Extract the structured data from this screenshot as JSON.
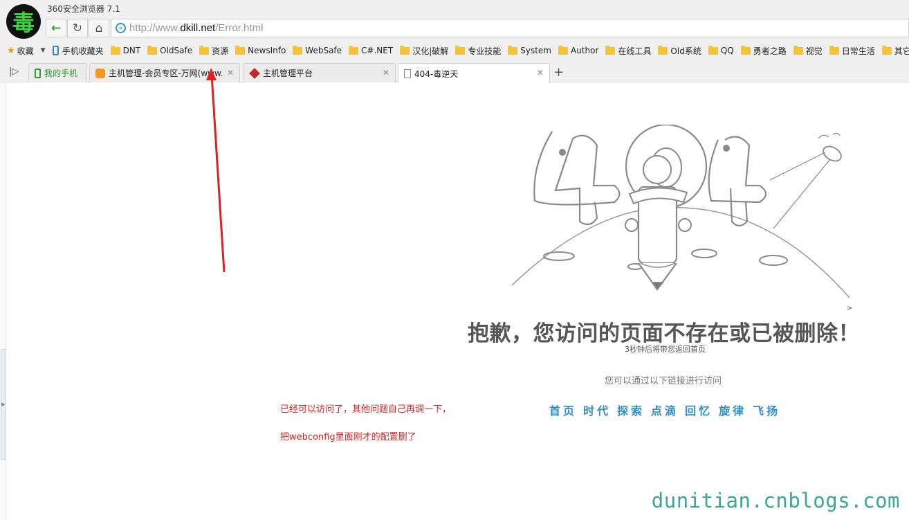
{
  "browser": {
    "app_title": "360安全浏览器 7.1",
    "logo_glyph": "毒",
    "url_prefix": "http://www.",
    "url_domain": "dkill.net",
    "url_path": "/Error.html"
  },
  "bookmarks": {
    "favorites_label": "收藏",
    "mobile_label": "手机收藏夹",
    "items": [
      "DNT",
      "OldSafe",
      "资源",
      "NewsInfo",
      "WebSafe",
      "C#.NET",
      "汉化|破解",
      "专业技能",
      "System",
      "Author",
      "在线工具",
      "Old系统",
      "QQ",
      "勇者之路",
      "视觉",
      "日常生活",
      "其它"
    ]
  },
  "tabs": [
    {
      "label": "我的手机"
    },
    {
      "label": "主机管理-会员专区-万网(www."
    },
    {
      "label": "主机管理平台"
    },
    {
      "label": "404-毒逆天"
    }
  ],
  "page": {
    "title": "抱歉，您访问的页面不存在或已被删除！",
    "subtitle": "3秒钟后将带您返回首页",
    "hint": "您可以通过以下链接进行访问",
    "links": [
      "首页",
      "时代",
      "探索",
      "点滴",
      "回忆",
      "旋律",
      "飞扬"
    ],
    "caret": ">"
  },
  "annotations": {
    "note1": "已经可以访问了，其他问题自己再调一下，",
    "note2": "把webconfig里面刚才的配置删了",
    "arrow_color": "#e02020"
  },
  "watermark": "dunitian.cnblogs.com",
  "colors": {
    "link_blue": "#2d8fc9",
    "annotation_red": "#e02020",
    "watermark_teal": "#3aa79a",
    "logo_green": "#3fd43f"
  }
}
